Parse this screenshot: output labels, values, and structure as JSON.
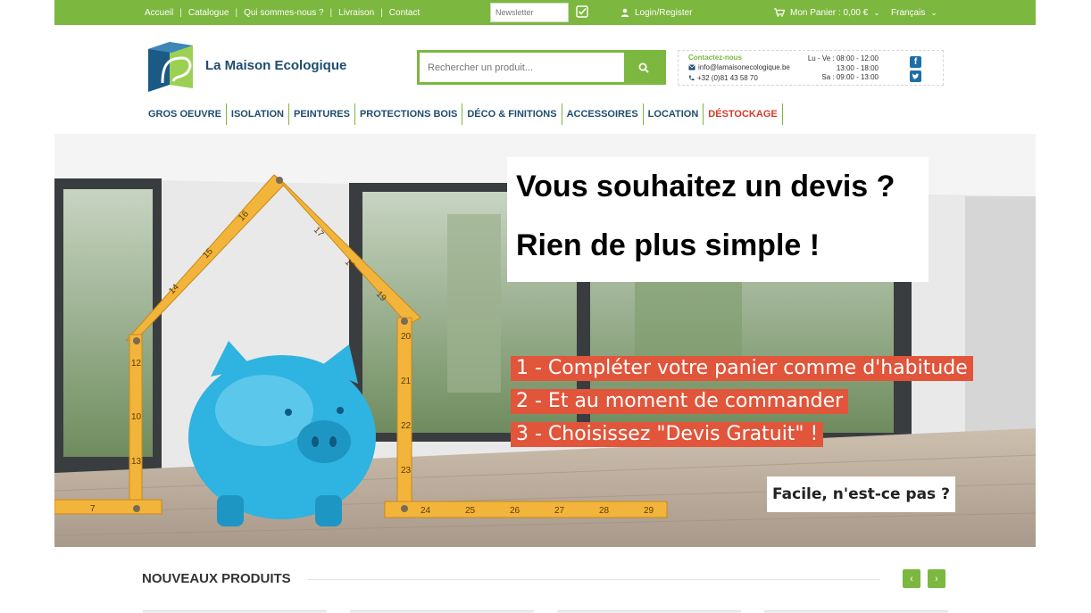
{
  "topbar": {
    "links": [
      "Accueil",
      "Catalogue",
      "Qui sommes-nous ?",
      "Livraison",
      "Contact"
    ],
    "newsletter_placeholder": "Newsletter",
    "login_label": "Login/Register",
    "cart_label": "Mon Panier : 0,00 €",
    "language": "Français"
  },
  "header": {
    "brand": "La Maison Ecologique",
    "search_placeholder": "Rechercher un produit...",
    "contact": {
      "title": "Contactez-nous",
      "email": "info@lamaisonecologique.be",
      "phone": "+32 (0)81 43 58 70",
      "hours": [
        "Lu - Ve : 08:00 - 12:00",
        "13:00 - 18:00",
        "Sa : 09:00 - 13:00"
      ]
    }
  },
  "nav": {
    "items": [
      "GROS OEUVRE",
      "ISOLATION",
      "PEINTURES",
      "PROTECTIONS BOIS",
      "DÉCO & FINITIONS",
      "ACCESSOIRES",
      "LOCATION",
      "DÉSTOCKAGE"
    ]
  },
  "hero": {
    "title_line1": "Vous souhaitez un devis ?",
    "title_line2": "Rien de plus simple !",
    "steps": [
      "1 - Compléter votre panier comme d'habitude",
      "2 - Et au moment de commander",
      "3 - Choisissez \"Devis Gratuit\" !"
    ],
    "tagline": "Facile, n'est-ce pas ?",
    "ruler_numbers": [
      "14",
      "15",
      "16",
      "17",
      "18",
      "19",
      "20",
      "21",
      "22",
      "23",
      "24",
      "25",
      "26",
      "27",
      "28",
      "29",
      "10",
      "12",
      "13",
      "7"
    ]
  },
  "new_products": {
    "title": "NOUVEAUX PRODUITS",
    "prev_icon": "chevron-left-icon",
    "next_icon": "chevron-right-icon"
  },
  "colors": {
    "brand_green": "#7cb73f",
    "brand_blue": "#1e4d6e",
    "accent_red": "#d63a2a",
    "step_orange": "#e1553b"
  }
}
